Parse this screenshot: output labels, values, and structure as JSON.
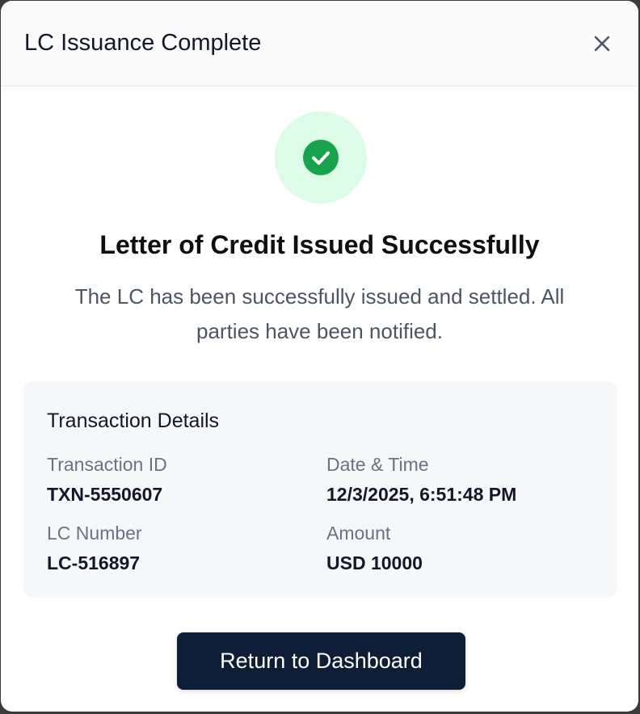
{
  "modal": {
    "title": "LC Issuance Complete",
    "close_icon": "close-icon"
  },
  "status": {
    "icon": "check-circle-icon",
    "accent_color": "#16a34a",
    "halo_color": "#dcfce7",
    "headline": "Letter of Credit Issued Successfully",
    "message": "The LC has been successfully issued and settled. All parties have been notified."
  },
  "details": {
    "title": "Transaction Details",
    "fields": [
      {
        "label": "Transaction ID",
        "value": "TXN-5550607"
      },
      {
        "label": "Date & Time",
        "value": "12/3/2025, 6:51:48 PM"
      },
      {
        "label": "LC Number",
        "value": "LC-516897"
      },
      {
        "label": "Amount",
        "value": "USD 10000"
      }
    ]
  },
  "actions": {
    "primary_label": "Return to Dashboard",
    "primary_color": "#0e1e36"
  }
}
